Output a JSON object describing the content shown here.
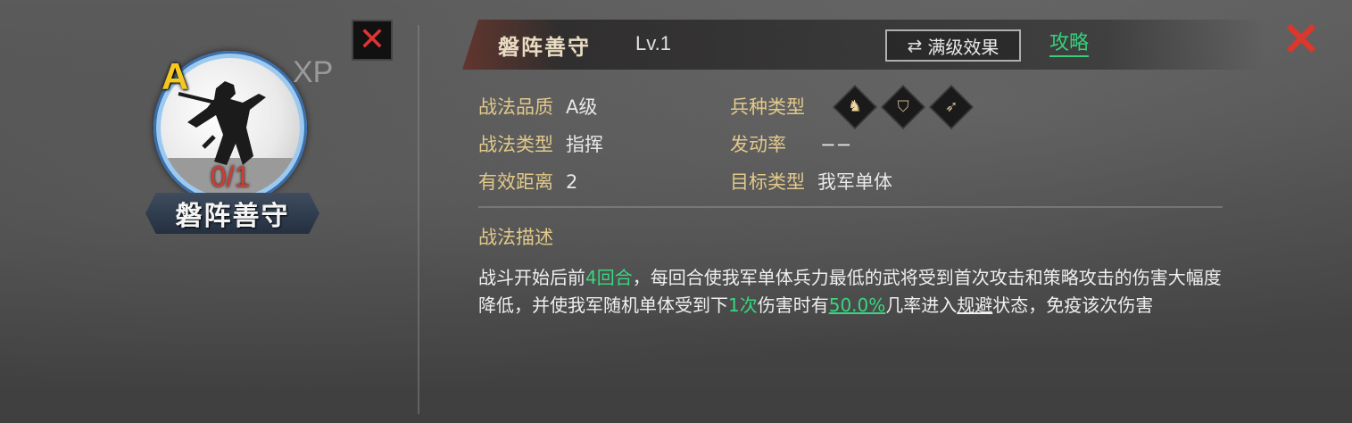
{
  "portrait": {
    "grade": "A",
    "xp_label": "XP",
    "count": "0/1",
    "name": "磐阵善守",
    "close_glyph": "✕"
  },
  "header": {
    "title": "磐阵善守",
    "level": "Lv.1",
    "max_effect_label": "满级效果",
    "max_effect_icon": "swap-icon",
    "strategy_label": "攻略",
    "close_glyph": "✕"
  },
  "attributes": {
    "quality_key": "战法品质",
    "quality_val": "A级",
    "type_key": "战法类型",
    "type_val": "指挥",
    "range_key": "有效距离",
    "range_val": "2",
    "unit_key": "兵种类型",
    "trigger_key": "发动率",
    "trigger_val": "−−",
    "target_key": "目标类型",
    "target_val": "我军单体",
    "unit_icons": [
      "cavalry-icon",
      "shield-infantry-icon",
      "archer-icon"
    ]
  },
  "description": {
    "heading": "战法描述",
    "p1": "战斗开始后前",
    "hl1": "4回合",
    "p2": "，每回合使我军单体兵力最低的武将受到首次攻击和策略攻击的伤害大幅度降低，并使我军随机单体受到下",
    "hl2": "1次",
    "p3": "伤害时有",
    "hl3": "50.0%",
    "p4": "几率进入",
    "u1": "规避",
    "p5": "状态，免疫该次伤害"
  },
  "colors": {
    "accent_green": "#38d67f",
    "key_gold": "#e2c98a",
    "close_red": "#d8382d",
    "grade_yellow": "#f4c820"
  }
}
